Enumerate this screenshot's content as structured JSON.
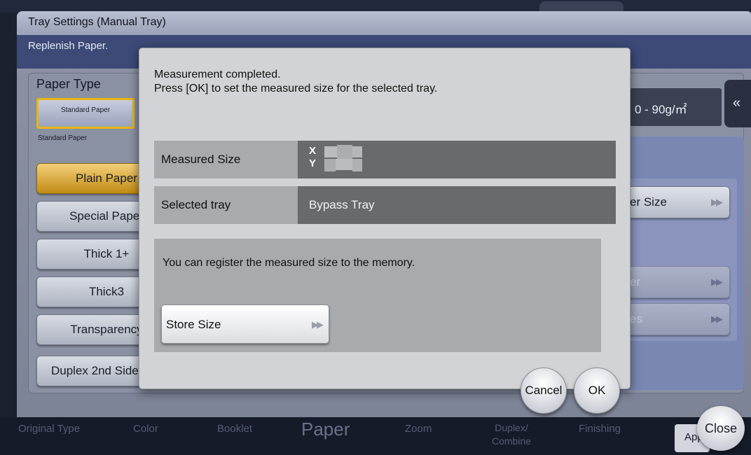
{
  "background": {
    "window_title": "Tray Settings (Manual Tray)",
    "message": "Replenish Paper.",
    "paper_type_label": "Paper Type",
    "standard_paper_button": "Standard Paper",
    "standard_paper_caption": "Standard Paper",
    "left_buttons": [
      "Plain Paper",
      "Special Paper",
      "Thick 1+",
      "Thick3",
      "Transparency",
      "Duplex 2nd Side"
    ],
    "weight_display": "0 - 90g/㎡",
    "right_buttons": [
      "er Size",
      "er",
      "es"
    ],
    "bottom_tabs": [
      "Original Type",
      "Color",
      "Booklet",
      "Paper",
      "Zoom",
      "Duplex/ Combine",
      "Finishing"
    ],
    "apply_label": "Apply",
    "close_label": "Close"
  },
  "dialog": {
    "message_line1": "Measurement completed.",
    "message_line2": "Press [OK] to set the measured size for the selected tray.",
    "measured_size_label": "Measured Size",
    "measured_size_x": "X",
    "measured_size_y": "Y",
    "selected_tray_label": "Selected tray",
    "selected_tray_value": "Bypass Tray",
    "register_text": "You can register the measured size to the memory.",
    "store_size_label": "Store Size",
    "cancel_label": "Cancel",
    "ok_label": "OK"
  },
  "colors": {
    "active_accent": "#e7b514",
    "message_bar": "#3d4a77",
    "dialog_bg": "#d2d3d6"
  }
}
